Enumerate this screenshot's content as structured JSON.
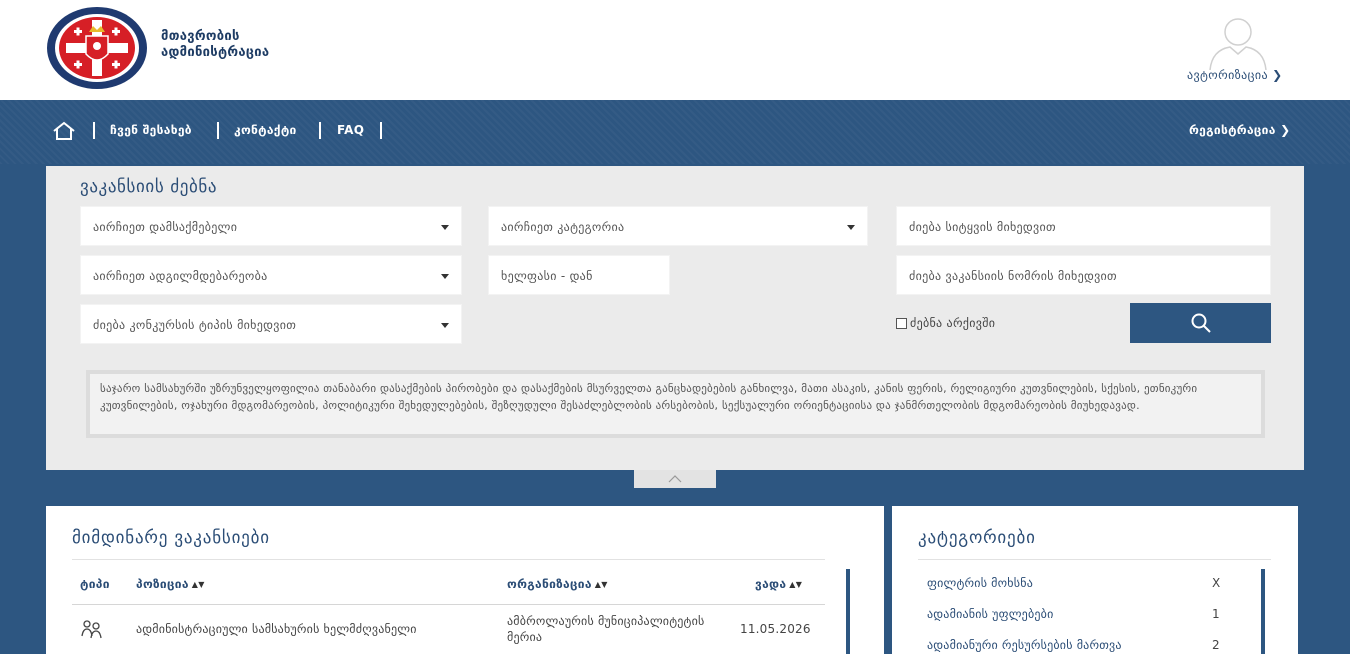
{
  "header": {
    "logo_line1": "მთავრობის",
    "logo_line2": "ადმინისტრაცია",
    "auth_label": "ავტორიზაცია ❯"
  },
  "nav": {
    "items": [
      "ჩვენ შესახებ",
      "კონტაქტი",
      "FAQ"
    ],
    "register_label": "რეგისტრაცია ❯"
  },
  "search": {
    "title": "ვაკანსიის ძებნა",
    "employer_placeholder": "აირჩიეთ დამსაქმებელი",
    "category_placeholder": "აირჩიეთ კატეგორია",
    "keyword_placeholder": "ძიება სიტყვის მიხედვით",
    "location_placeholder": "აირჩიეთ ადგილმდებარეობა",
    "salary_placeholder": "ხელფასი - დან",
    "vacancy_number_placeholder": "ძიება ვაკანსიის ნომრის მიხედვით",
    "contest_type_placeholder": "ძიება კონკურსის ტიპის მიხედვით",
    "archive_label": "ძებნა არქივში",
    "notice": "საჯარო სამსახურში უზრუნველყოფილია თანაბარი დასაქმების პირობები და დასაქმების მსურველთა განცხადებების განხილვა, მათი ასაკის, კანის ფერის, რელიგიური კუთვნილების, სქესის, ეთნიკური კუთვნილების, ოჯახური მდგომარეობის, პოლიტიკური შეხედულებების, შეზღუდული შესაძლებლობის არსებობის, სექსუალური ორიენტაციისა და ჯანმრთელობის მდგომარეობის მიუხედავად."
  },
  "vacancies": {
    "title": "მიმდინარე ვაკანსიები",
    "columns": [
      "ტიპი",
      "პოზიცია",
      "ორგანიზაცია",
      "ვადა"
    ],
    "rows": [
      {
        "position": "ადმინისტრაციული სამსახურის ხელმძღვანელი",
        "organization_line1": "ამბროლაურის მუნიციპალიტეტის",
        "organization_line2": "მერია",
        "deadline": "11.05.2026"
      }
    ]
  },
  "categories": {
    "title": "კატეგორიები",
    "items": [
      {
        "label": "ფილტრის მოხსნა",
        "count": "X"
      },
      {
        "label": "ადამიანის უფლებები",
        "count": "1"
      },
      {
        "label": "ადამიანური რესურსების მართვა",
        "count": "2"
      }
    ]
  },
  "colors": {
    "brand_blue": "#2d5681",
    "panel_gray": "#ebebeb",
    "text_blue": "#2b4d76"
  }
}
